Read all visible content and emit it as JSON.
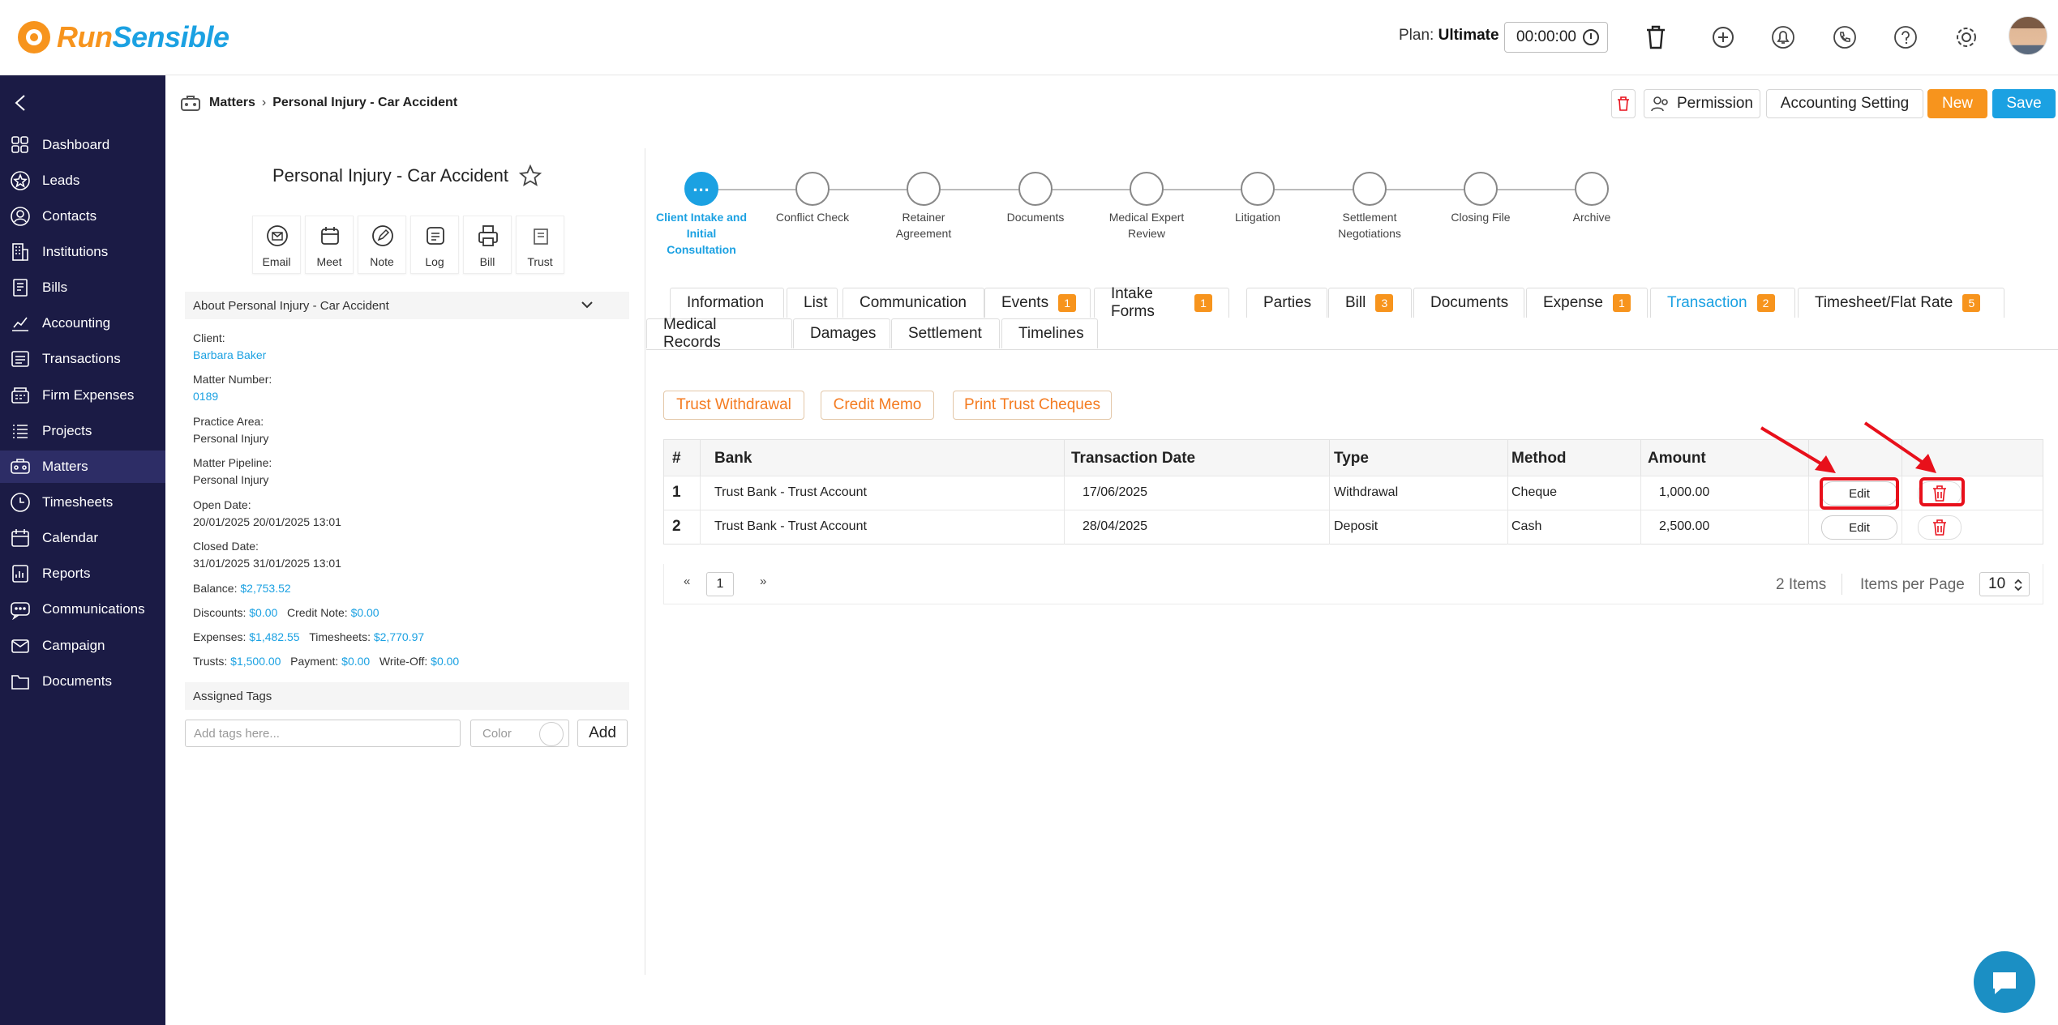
{
  "app": {
    "brand_run": "Run",
    "brand_sensible": "Sensible"
  },
  "header": {
    "plan_label": "Plan:",
    "plan_value": "Ultimate",
    "timer": "00:00:00",
    "icons": [
      "trash-icon",
      "add-timer-icon",
      "bell-icon",
      "phone-icon",
      "help-icon",
      "gear-icon"
    ]
  },
  "sidebar": {
    "items": [
      {
        "label": "Dashboard",
        "icon": "dashboard-icon"
      },
      {
        "label": "Leads",
        "icon": "star-icon"
      },
      {
        "label": "Contacts",
        "icon": "contact-icon"
      },
      {
        "label": "Institutions",
        "icon": "building-icon"
      },
      {
        "label": "Bills",
        "icon": "bill-icon"
      },
      {
        "label": "Accounting",
        "icon": "chart-icon"
      },
      {
        "label": "Transactions",
        "icon": "transaction-icon"
      },
      {
        "label": "Firm Expenses",
        "icon": "register-icon"
      },
      {
        "label": "Projects",
        "icon": "list-icon"
      },
      {
        "label": "Matters",
        "icon": "briefcase-icon"
      },
      {
        "label": "Timesheets",
        "icon": "clock-icon"
      },
      {
        "label": "Calendar",
        "icon": "calendar-icon"
      },
      {
        "label": "Reports",
        "icon": "report-icon"
      },
      {
        "label": "Communications",
        "icon": "chat-icon"
      },
      {
        "label": "Campaign",
        "icon": "mail-icon"
      },
      {
        "label": "Documents",
        "icon": "folder-icon"
      }
    ],
    "active": "Matters"
  },
  "breadcrumb": {
    "root": "Matters",
    "current": "Personal Injury - Car Accident"
  },
  "actions": {
    "permission": "Permission",
    "accounting": "Accounting Setting",
    "new": "New",
    "save": "Save"
  },
  "matter": {
    "title": "Personal Injury - Car Accident",
    "quick_actions": [
      "Email",
      "Meet",
      "Note",
      "Log",
      "Bill",
      "Trust"
    ],
    "about_title": "About Personal Injury - Car Accident",
    "client_label": "Client:",
    "client": "Barbara Baker",
    "number_label": "Matter Number:",
    "number": "0189",
    "practice_label": "Practice Area:",
    "practice": "Personal Injury",
    "pipeline_label": "Matter Pipeline:",
    "pipeline": "Personal Injury",
    "open_label": "Open Date:",
    "open": "20/01/2025 20/01/2025 13:01",
    "closed_label": "Closed Date:",
    "closed": "31/01/2025 31/01/2025 13:01",
    "balance_label": "Balance:",
    "balance": "$2,753.52",
    "discounts_label": "Discounts:",
    "discounts": "$0.00",
    "credit_label": "Credit Note:",
    "credit": "$0.00",
    "expenses_label": "Expenses:",
    "expenses": "$1,482.55",
    "timesheets_label": "Timesheets:",
    "timesheets": "$2,770.97",
    "trusts_label": "Trusts:",
    "trusts": "$1,500.00",
    "payment_label": "Payment:",
    "payment": "$0.00",
    "writeoff_label": "Write-Off:",
    "writeoff": "$0.00",
    "tags_title": "Assigned Tags",
    "tags_placeholder": "Add tags here...",
    "color_label": "Color",
    "add_label": "Add"
  },
  "pipeline": {
    "active_dot": "...",
    "stages": [
      {
        "line1": "Client Intake and",
        "line2": "Initial",
        "line3": "Consultation"
      },
      {
        "line1": "Conflict Check",
        "line2": "",
        "line3": ""
      },
      {
        "line1": "Retainer",
        "line2": "Agreement",
        "line3": ""
      },
      {
        "line1": "Documents",
        "line2": "",
        "line3": ""
      },
      {
        "line1": "Medical Expert",
        "line2": "Review",
        "line3": ""
      },
      {
        "line1": "Litigation",
        "line2": "",
        "line3": ""
      },
      {
        "line1": "Settlement",
        "line2": "Negotiations",
        "line3": ""
      },
      {
        "line1": "Closing File",
        "line2": "",
        "line3": ""
      },
      {
        "line1": "Archive",
        "line2": "",
        "line3": ""
      }
    ]
  },
  "tabs": {
    "row1": [
      {
        "label": "Information",
        "badge": ""
      },
      {
        "label": "List",
        "badge": ""
      },
      {
        "label": "Communication",
        "badge": ""
      },
      {
        "label": "Events",
        "badge": "1"
      },
      {
        "label": "Intake Forms",
        "badge": "1"
      },
      {
        "label": "Parties",
        "badge": ""
      },
      {
        "label": "Bill",
        "badge": "3"
      },
      {
        "label": "Documents",
        "badge": ""
      },
      {
        "label": "Expense",
        "badge": "1"
      },
      {
        "label": "Transaction",
        "badge": "2"
      },
      {
        "label": "Timesheet/Flat Rate",
        "badge": "5"
      }
    ],
    "row2": [
      {
        "label": "Medical Records"
      },
      {
        "label": "Damages"
      },
      {
        "label": "Settlement"
      },
      {
        "label": "Timelines"
      }
    ],
    "active": "Transaction"
  },
  "transactions": {
    "buttons": {
      "trust_withdrawal": "Trust Withdrawal",
      "credit_memo": "Credit Memo",
      "print_cheques": "Print Trust Cheques"
    },
    "headers": {
      "num": "#",
      "bank": "Bank",
      "date": "Transaction Date",
      "type": "Type",
      "method": "Method",
      "amount": "Amount"
    },
    "rows": [
      {
        "num": "1",
        "bank": "Trust Bank - Trust Account",
        "date": "17/06/2025",
        "type": "Withdrawal",
        "method": "Cheque",
        "amount": "1,000.00",
        "edit": "Edit"
      },
      {
        "num": "2",
        "bank": "Trust Bank - Trust Account",
        "date": "28/04/2025",
        "type": "Deposit",
        "method": "Cash",
        "amount": "2,500.00",
        "edit": "Edit"
      }
    ],
    "pager": {
      "prev": "«",
      "page": "1",
      "next": "»",
      "count": "2 Items",
      "per_page_label": "Items per Page",
      "per_page": "10"
    }
  },
  "colors": {
    "accent": "#1ba1e2",
    "orange": "#f7941d",
    "sidebar": "#1b1b45",
    "highlight": "#e8101b"
  }
}
